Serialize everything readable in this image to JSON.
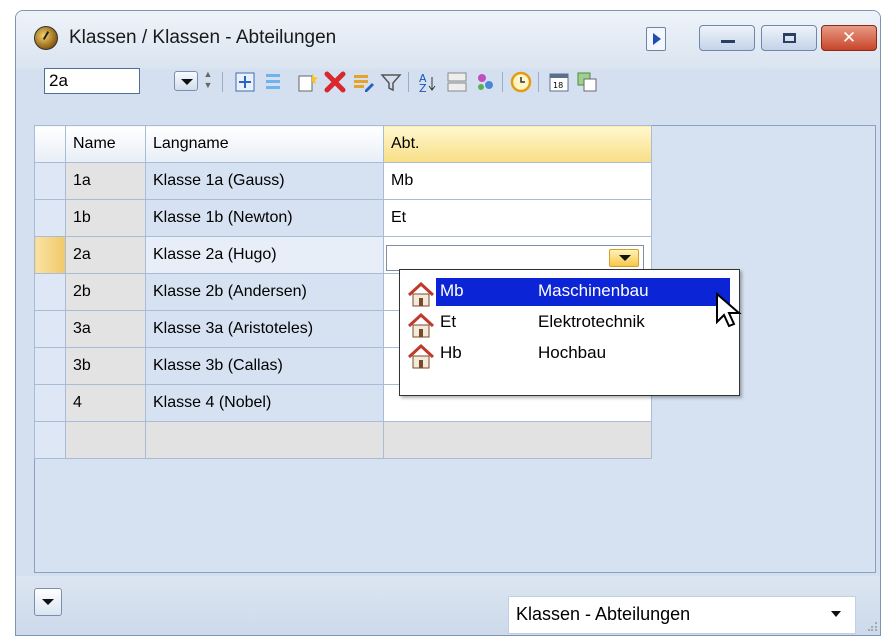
{
  "window": {
    "title": "Klassen / Klassen - Abteilungen"
  },
  "toolbar": {
    "class_value": "2a",
    "icons": [
      "details-icon",
      "list-icon",
      "new-record-icon",
      "delete-icon",
      "edit-icon",
      "filter-icon",
      "sort-icon",
      "grid-icon",
      "group-icon",
      "clock-icon",
      "calendar-icon",
      "copy-icon"
    ]
  },
  "grid": {
    "columns": [
      "Name",
      "Langname",
      "Abt."
    ],
    "rows": [
      {
        "name": "1a",
        "langname": "Klasse 1a (Gauss)",
        "abt": "Mb"
      },
      {
        "name": "1b",
        "langname": "Klasse 1b (Newton)",
        "abt": "Et"
      },
      {
        "name": "2a",
        "langname": "Klasse 2a (Hugo)",
        "abt": ""
      },
      {
        "name": "2b",
        "langname": "Klasse 2b (Andersen)",
        "abt": ""
      },
      {
        "name": "3a",
        "langname": "Klasse 3a (Aristoteles)",
        "abt": ""
      },
      {
        "name": "3b",
        "langname": "Klasse 3b (Callas)",
        "abt": ""
      },
      {
        "name": "4",
        "langname": "Klasse 4 (Nobel)",
        "abt": ""
      }
    ],
    "current_row": "2a"
  },
  "dropdown": {
    "options": [
      {
        "code": "Mb",
        "name": "Maschinenbau",
        "selected": true
      },
      {
        "code": "Et",
        "name": "Elektrotechnik",
        "selected": false
      },
      {
        "code": "Hb",
        "name": "Hochbau",
        "selected": false
      }
    ],
    "icon": "department-house-icon"
  },
  "footer": {
    "view_selector": "Klassen - Abteilungen"
  },
  "colors": {
    "titlebar": "#dae4f0",
    "selection": "#0a24d6",
    "current_row_marker": "#f1c869",
    "header_highlight": "#f8de86"
  }
}
